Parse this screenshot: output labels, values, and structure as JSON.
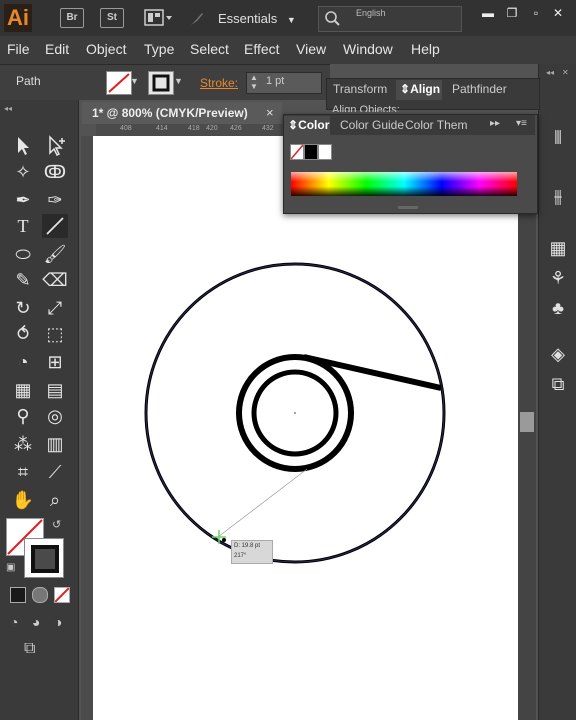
{
  "titlebar": {
    "logo": "Ai",
    "bridge_badge": "Br",
    "stock_badge": "St",
    "workspace": "Essentials",
    "search_language": "English",
    "workspace_icon": "arrange-documents-icon",
    "search_icon": "search-icon"
  },
  "menu": [
    "File",
    "Edit",
    "Object",
    "Type",
    "Select",
    "Effect",
    "View",
    "Window",
    "Help"
  ],
  "control": {
    "selection_label": "Path",
    "stroke_label": "Stroke:",
    "stroke_value": "1 pt"
  },
  "document": {
    "tab_title": "1* @ 800% (CMYK/Preview)",
    "close_glyph": "×",
    "ruler_ticks": [
      "408",
      "414",
      "418",
      "420",
      "426",
      "432"
    ]
  },
  "panels": {
    "transform_tab": "Transform",
    "align_tab": "Align",
    "pathfinder_tab": "Pathfinder",
    "align_objects": "Align Objects:",
    "color_tab": "Color",
    "color_guide_tab": "Color Guide",
    "color_themes_tab": "Color Them",
    "menu_glyph": "▸▸"
  },
  "canvas": {
    "measure_distance": "D: 19.8 pt",
    "measure_angle": "217°"
  },
  "colors": {
    "accent": "#e8882d",
    "panel_bg": "#3a3a3a",
    "artboard": "#ffffff",
    "stroke": "#000000",
    "selection_path": "#3a3d7a"
  }
}
